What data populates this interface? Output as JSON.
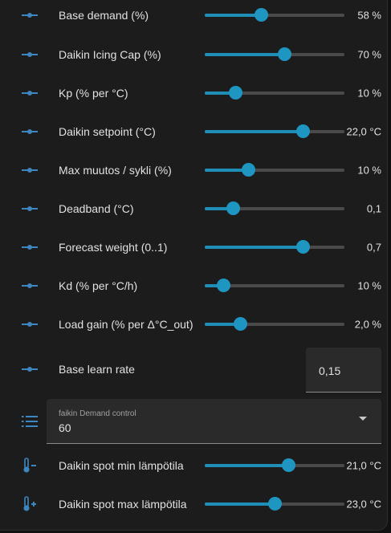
{
  "colors": {
    "accent": "#1f95c2",
    "icon": "#3d87c0",
    "background": "#1c1c1c"
  },
  "sliders": [
    {
      "id": "base-demand",
      "label": "Base demand (%)",
      "value": "58 %",
      "fraction": 0.4,
      "icon": "slider-icon"
    },
    {
      "id": "daikin-icing-cap",
      "label": "Daikin Icing Cap (%)",
      "value": "70 %",
      "fraction": 0.57,
      "icon": "slider-icon"
    },
    {
      "id": "kp",
      "label": "Kp (% per °C)",
      "value": "10 %",
      "fraction": 0.22,
      "icon": "slider-icon"
    },
    {
      "id": "daikin-setpoint",
      "label": "Daikin setpoint (°C)",
      "value": "22,0 °C",
      "fraction": 0.7,
      "icon": "slider-icon"
    },
    {
      "id": "max-muutos",
      "label": "Max muutos / sykli (%)",
      "value": "10 %",
      "fraction": 0.31,
      "icon": "slider-icon"
    },
    {
      "id": "deadband",
      "label": "Deadband (°C)",
      "value": "0,1",
      "fraction": 0.2,
      "icon": "slider-icon"
    },
    {
      "id": "forecast-weight",
      "label": "Forecast weight (0..1)",
      "value": "0,7",
      "fraction": 0.7,
      "icon": "slider-icon"
    },
    {
      "id": "kd",
      "label": "Kd (% per °C/h)",
      "value": "10 %",
      "fraction": 0.13,
      "icon": "slider-icon"
    },
    {
      "id": "load-gain",
      "label": "Load gain (% per Δ°C_out)",
      "value": "2,0 %",
      "fraction": 0.25,
      "icon": "slider-icon"
    }
  ],
  "base_learn_rate": {
    "label": "Base learn rate",
    "value": "0,15",
    "icon": "slider-icon"
  },
  "demand_control": {
    "label": "faikin Demand control",
    "value": "60",
    "icon": "format-list-icon"
  },
  "spot_sliders": [
    {
      "id": "spot-min",
      "label": "Daikin spot min lämpötila",
      "value": "21,0 °C",
      "fraction": 0.6,
      "icon": "thermometer-minus-icon"
    },
    {
      "id": "spot-max",
      "label": "Daikin spot max lämpötila",
      "value": "23,0 °C",
      "fraction": 0.5,
      "icon": "thermometer-plus-icon"
    }
  ]
}
